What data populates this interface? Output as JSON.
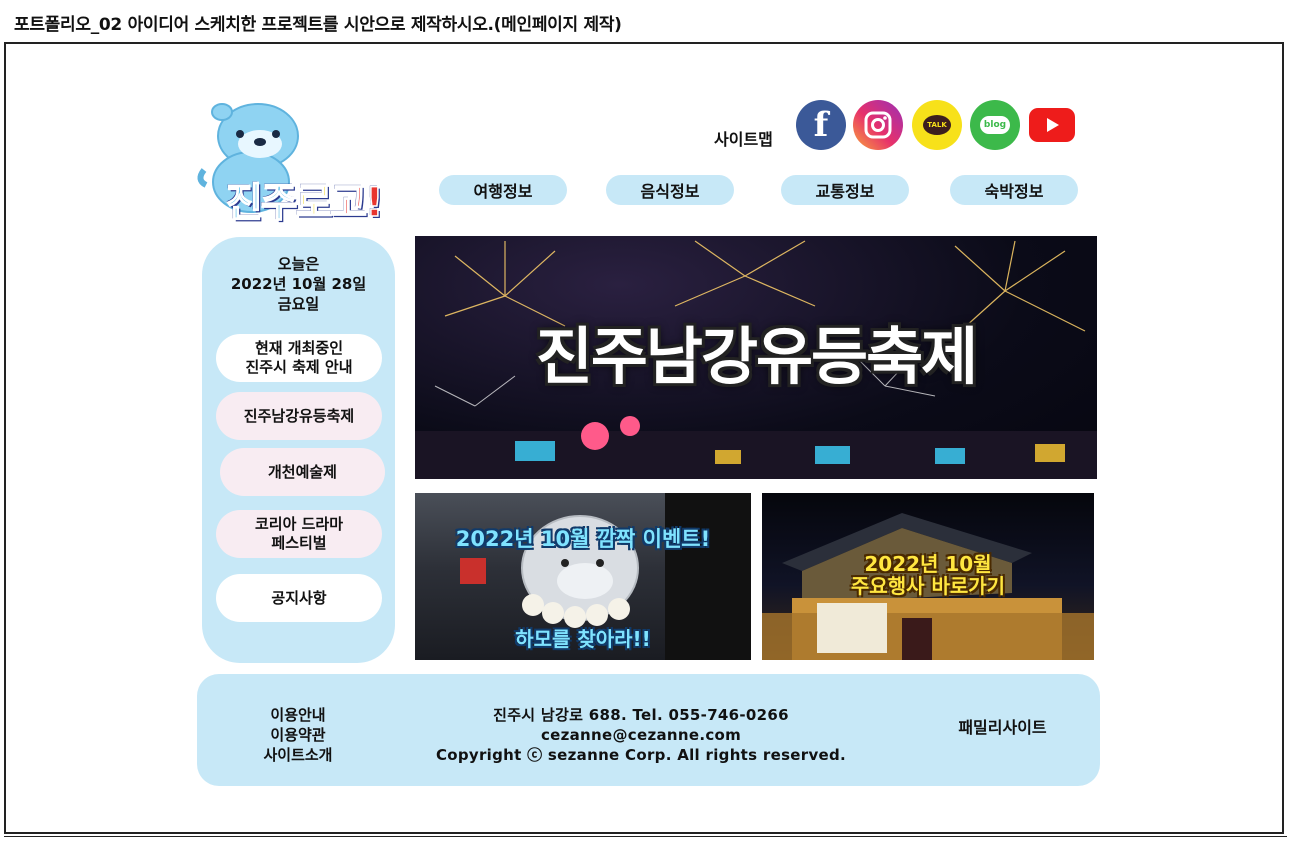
{
  "caption": "포트폴리오_02 아이디어 스케치한 프로젝트를 시안으로 제작하시오.(메인페이지 제작)",
  "logo": {
    "part1": "진주",
    "part2": "로",
    "part3": "고!"
  },
  "header": {
    "sitemap": "사이트맵",
    "sns": {
      "facebook": "f",
      "kakaotalk": "TALK",
      "blog": "blog"
    }
  },
  "nav": [
    "여행정보",
    "음식정보",
    "교통정보",
    "숙박정보"
  ],
  "side": {
    "date_line1": "오늘은",
    "date_line2": "2022년 10월 28일",
    "date_line3": "금요일",
    "current_line1": "현재 개최중인",
    "current_line2": "진주시 축제 안내",
    "item1": "진주남강유등축제",
    "item2": "개천예술제",
    "item3_line1": "코리아 드라마",
    "item3_line2": "페스티벌",
    "notice": "공지사항"
  },
  "banners": {
    "main_title": "진주남강유등축제",
    "event_line1": "2022년 10월 깜짝 이벤트!",
    "event_line2": "하모를 찾아라!!",
    "schedule_line1": "2022년 10월",
    "schedule_line2": "주요행사 바로가기"
  },
  "footer": {
    "link1": "이용안내",
    "link2": "이용약관",
    "link3": "사이트소개",
    "address": "진주시 남강로 688. Tel. 055-746-0266",
    "email": "cezanne@cezanne.com",
    "copyright": "Copyright ⓒ sezanne Corp. All rights reserved.",
    "family": "패밀리사이트"
  },
  "colors": {
    "accent": "#c7e8f7",
    "pink": "#f8ecf2"
  }
}
